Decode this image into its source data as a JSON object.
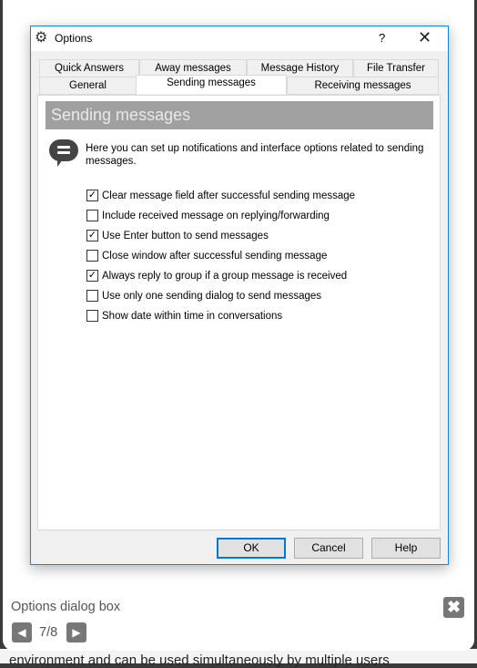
{
  "background": {
    "text": "environment and can be used simultaneously by multiple users"
  },
  "dialog": {
    "title": "Options",
    "help_label": "?",
    "close_label": "✕",
    "tabs_row1": [
      "Quick Answers",
      "Away messages",
      "Message History",
      "File Transfer"
    ],
    "tabs_row2": [
      "General",
      "Sending messages",
      "Receiving messages"
    ],
    "active_tab": "Sending messages",
    "header": "Sending messages",
    "description": "Here you can set up notifications and interface options related to sending messages.",
    "options": [
      {
        "label": "Clear message field after successful sending message",
        "checked": true
      },
      {
        "label": "Include received message on replying/forwarding",
        "checked": false
      },
      {
        "label": "Use Enter button to send messages",
        "checked": true
      },
      {
        "label": "Close window after successful sending message",
        "checked": false
      },
      {
        "label": "Always reply to group if a group message is received",
        "checked": true
      },
      {
        "label": "Use only one sending dialog to send messages",
        "checked": false
      },
      {
        "label": "Show date within time in conversations",
        "checked": false
      }
    ],
    "buttons": {
      "ok": "OK",
      "cancel": "Cancel",
      "help": "Help"
    }
  },
  "lightbox": {
    "caption": "Options dialog box",
    "counter": "7/8",
    "prev_icon": "◀",
    "next_icon": "▶",
    "close_icon": "✖"
  }
}
